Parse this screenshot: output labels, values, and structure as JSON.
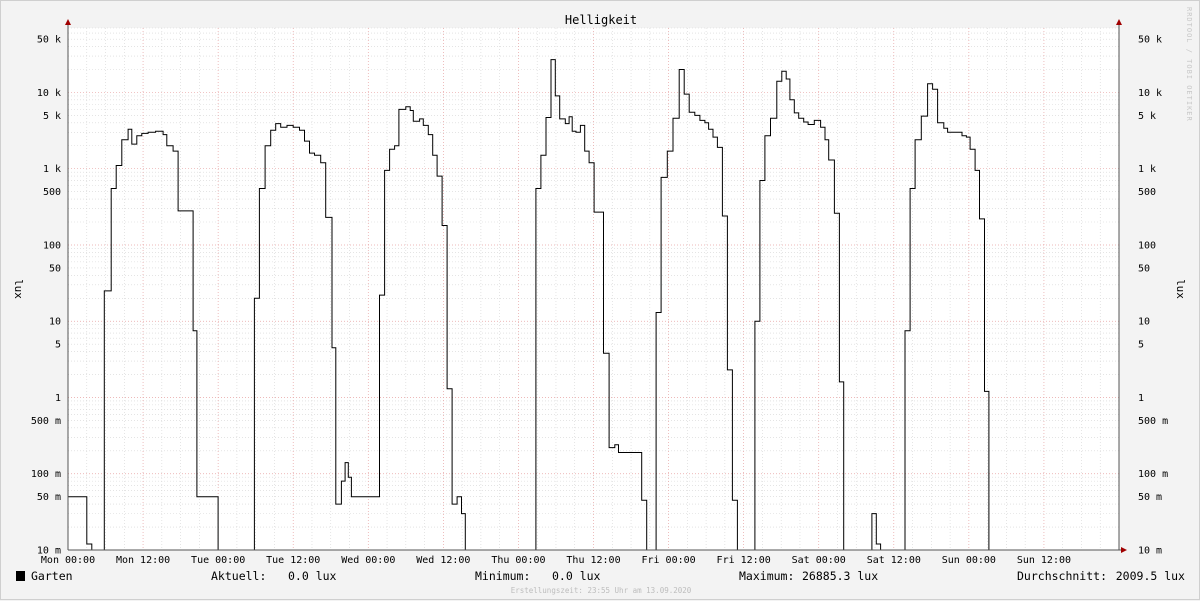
{
  "chart_data": {
    "type": "line",
    "title": "Helligkeit",
    "ylabel": "lux",
    "scale": "log",
    "ylim": [
      0.01,
      70000
    ],
    "y_ticks": [
      {
        "value": 50000,
        "label": "50 k"
      },
      {
        "value": 10000,
        "label": "10 k"
      },
      {
        "value": 5000,
        "label": "5 k"
      },
      {
        "value": 1000,
        "label": "1 k"
      },
      {
        "value": 500,
        "label": "500"
      },
      {
        "value": 100,
        "label": "100"
      },
      {
        "value": 50,
        "label": "50"
      },
      {
        "value": 10,
        "label": "10"
      },
      {
        "value": 5,
        "label": "5"
      },
      {
        "value": 1,
        "label": "1"
      },
      {
        "value": 0.5,
        "label": "500 m"
      },
      {
        "value": 0.1,
        "label": "100 m"
      },
      {
        "value": 0.05,
        "label": "50 m"
      },
      {
        "value": 0.01,
        "label": "10 m"
      }
    ],
    "xlim_hours": [
      0,
      168
    ],
    "x_ticks": [
      {
        "hour": 0,
        "label": "Mon 00:00"
      },
      {
        "hour": 12,
        "label": "Mon 12:00"
      },
      {
        "hour": 24,
        "label": "Tue 00:00"
      },
      {
        "hour": 36,
        "label": "Tue 12:00"
      },
      {
        "hour": 48,
        "label": "Wed 00:00"
      },
      {
        "hour": 60,
        "label": "Wed 12:00"
      },
      {
        "hour": 72,
        "label": "Thu 00:00"
      },
      {
        "hour": 84,
        "label": "Thu 12:00"
      },
      {
        "hour": 96,
        "label": "Fri 00:00"
      },
      {
        "hour": 108,
        "label": "Fri 12:00"
      },
      {
        "hour": 120,
        "label": "Sat 00:00"
      },
      {
        "hour": 132,
        "label": "Sat 12:00"
      },
      {
        "hour": 144,
        "label": "Sun 00:00"
      },
      {
        "hour": 156,
        "label": "Sun 12:00"
      }
    ],
    "grid": true,
    "series": [
      {
        "name": "Garten",
        "color": "#000000",
        "points": [
          [
            0.0,
            0.05
          ],
          [
            3.0,
            0.012
          ],
          [
            3.8,
            0.01
          ],
          [
            5.8,
            25
          ],
          [
            6.9,
            550
          ],
          [
            7.7,
            1100
          ],
          [
            8.6,
            2400
          ],
          [
            9.6,
            3300
          ],
          [
            10.2,
            2100
          ],
          [
            11.0,
            2700
          ],
          [
            11.8,
            2900
          ],
          [
            12.8,
            3000
          ],
          [
            14.0,
            3100
          ],
          [
            15.2,
            2800
          ],
          [
            15.8,
            2000
          ],
          [
            16.8,
            1700
          ],
          [
            17.6,
            280
          ],
          [
            20.0,
            7.5
          ],
          [
            20.6,
            0.05
          ],
          [
            24.0,
            0.01
          ],
          [
            29.8,
            20
          ],
          [
            30.6,
            550
          ],
          [
            31.5,
            2000
          ],
          [
            32.4,
            3200
          ],
          [
            33.2,
            3900
          ],
          [
            34.0,
            3500
          ],
          [
            35.0,
            3700
          ],
          [
            36.0,
            3500
          ],
          [
            37.0,
            3200
          ],
          [
            37.8,
            2300
          ],
          [
            38.6,
            1600
          ],
          [
            39.4,
            1500
          ],
          [
            40.4,
            1200
          ],
          [
            41.2,
            230
          ],
          [
            42.2,
            4.5
          ],
          [
            42.8,
            0.04
          ],
          [
            43.7,
            0.08
          ],
          [
            44.3,
            0.14
          ],
          [
            44.8,
            0.09
          ],
          [
            45.3,
            0.05
          ],
          [
            49.8,
            22
          ],
          [
            50.6,
            950
          ],
          [
            51.4,
            1800
          ],
          [
            52.2,
            2000
          ],
          [
            52.9,
            6000
          ],
          [
            54.0,
            6500
          ],
          [
            54.7,
            5800
          ],
          [
            55.2,
            4200
          ],
          [
            56.2,
            4500
          ],
          [
            56.8,
            3700
          ],
          [
            57.6,
            2800
          ],
          [
            58.3,
            1500
          ],
          [
            59.0,
            800
          ],
          [
            59.8,
            180
          ],
          [
            60.6,
            1.3
          ],
          [
            61.4,
            0.04
          ],
          [
            62.2,
            0.05
          ],
          [
            62.9,
            0.03
          ],
          [
            63.5,
            0.01
          ],
          [
            74.8,
            550
          ],
          [
            75.6,
            1500
          ],
          [
            76.4,
            4700
          ],
          [
            77.2,
            27000
          ],
          [
            77.9,
            9000
          ],
          [
            78.6,
            4500
          ],
          [
            79.5,
            3900
          ],
          [
            80.1,
            4800
          ],
          [
            80.6,
            3100
          ],
          [
            81.2,
            3000
          ],
          [
            81.9,
            3700
          ],
          [
            82.6,
            1700
          ],
          [
            83.3,
            1200
          ],
          [
            84.1,
            270
          ],
          [
            85.6,
            3.8
          ],
          [
            86.5,
            0.22
          ],
          [
            87.4,
            0.24
          ],
          [
            88.0,
            0.19
          ],
          [
            91.0,
            0.19
          ],
          [
            91.7,
            0.045
          ],
          [
            92.5,
            0.008
          ],
          [
            94.0,
            13
          ],
          [
            94.8,
            770
          ],
          [
            95.8,
            1700
          ],
          [
            96.7,
            4600
          ],
          [
            97.7,
            20000
          ],
          [
            98.5,
            9500
          ],
          [
            99.3,
            5500
          ],
          [
            100.2,
            5000
          ],
          [
            101.0,
            4300
          ],
          [
            101.8,
            4000
          ],
          [
            102.4,
            3300
          ],
          [
            103.1,
            2600
          ],
          [
            103.8,
            1900
          ],
          [
            104.6,
            240
          ],
          [
            105.4,
            2.3
          ],
          [
            106.2,
            0.045
          ],
          [
            107.0,
            0.01
          ],
          [
            109.8,
            10
          ],
          [
            110.6,
            700
          ],
          [
            111.4,
            2700
          ],
          [
            112.3,
            4600
          ],
          [
            113.3,
            14000
          ],
          [
            114.1,
            19000
          ],
          [
            114.8,
            15000
          ],
          [
            115.4,
            8000
          ],
          [
            116.1,
            5400
          ],
          [
            116.8,
            4600
          ],
          [
            117.6,
            4100
          ],
          [
            118.3,
            3800
          ],
          [
            119.3,
            4300
          ],
          [
            120.3,
            3500
          ],
          [
            121.0,
            2400
          ],
          [
            121.6,
            1300
          ],
          [
            122.5,
            260
          ],
          [
            123.3,
            1.6
          ],
          [
            124.0,
            0.01
          ],
          [
            128.5,
            0.03
          ],
          [
            129.2,
            0.012
          ],
          [
            129.9,
            0.01
          ],
          [
            133.8,
            7.5
          ],
          [
            134.6,
            550
          ],
          [
            135.4,
            2400
          ],
          [
            136.4,
            4900
          ],
          [
            137.4,
            13000
          ],
          [
            138.2,
            11000
          ],
          [
            139.0,
            4000
          ],
          [
            140.0,
            3400
          ],
          [
            140.6,
            3000
          ],
          [
            141.4,
            3000
          ],
          [
            142.2,
            3000
          ],
          [
            142.9,
            2700
          ],
          [
            143.6,
            2600
          ],
          [
            144.2,
            1800
          ],
          [
            145.0,
            950
          ],
          [
            145.7,
            220
          ],
          [
            146.5,
            1.2
          ],
          [
            147.2,
            0.01
          ],
          [
            168.0,
            0.01
          ]
        ]
      }
    ],
    "legend": {
      "position": "bottom-left",
      "entries": [
        "Garten"
      ]
    }
  },
  "stats": {
    "current_label": "Aktuell:",
    "current_value": "0.0 lux",
    "min_label": "Minimum:",
    "min_value": "0.0 lux",
    "max_label": "Maximum:",
    "max_value": "26885.3 lux",
    "avg_label": "Durchschnitt:",
    "avg_value": "2009.5 lux"
  },
  "watermark": "RRDTOOL / TOBI OETIKER",
  "footer_note": "Erstellungszeit: 23:55 Uhr am 13.09.2020",
  "colors": {
    "background": "#f3f3f3",
    "plot_background": "#ffffff",
    "major_grid": "#e7a2a2",
    "minor_grid": "#d4d4d4",
    "line": "#000000",
    "axis_arrow": "#a00000"
  }
}
